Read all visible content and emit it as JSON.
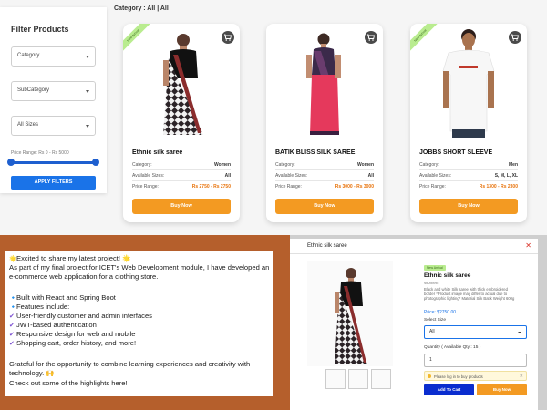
{
  "storefront": {
    "filter_title": "Filter Products",
    "category_placeholder": "Category",
    "subcategory_placeholder": "SubCategory",
    "size_value": "All Sizes",
    "price_range_label": "Price Range: Rs 0 - Rs 5000",
    "price_range": [
      0,
      5000
    ],
    "apply_label": "APPLY FILTERS",
    "breadcrumb": "Category : All | All",
    "labels": {
      "category": "Category:",
      "sizes": "Available Sizes:",
      "price": "Price Range:"
    },
    "products": [
      {
        "name": "Ethnic silk saree",
        "ribbon": "New Arrival",
        "category": "Women",
        "sizes": "All",
        "price": "Rs 2750 - Rs 2750",
        "buy_label": "Buy Now",
        "image": "saree-geometric"
      },
      {
        "name": "BATIK BLISS SILK SAREE",
        "ribbon": "",
        "category": "Women",
        "sizes": "All",
        "price": "Rs 3000 - Rs 3000",
        "buy_label": "Buy Now",
        "image": "saree-pink"
      },
      {
        "name": "JOBBS SHORT SLEEVE",
        "ribbon": "New Arrival",
        "category": "Men",
        "sizes": "S, M, L, XL",
        "price": "Rs 1300 - Rs 2300",
        "buy_label": "Buy Now",
        "image": "tshirt-white"
      }
    ],
    "icons": {
      "cart": "cart-icon"
    },
    "colors": {
      "accent": "#1a73e8",
      "buy": "#f39a22",
      "price": "#e8730b"
    }
  },
  "post": {
    "lines": [
      {
        "icon": "🌟",
        "text": "Excited to share my latest project! 🌟"
      },
      {
        "icon": "",
        "text": "As part of my final project for ICET's Web Development module, I have developed an"
      },
      {
        "icon": "",
        "text": "e-commerce web application for a clothing store."
      },
      {
        "icon": "",
        "text": ""
      },
      {
        "icon": "🔹",
        "text": "Built with React and Spring Boot"
      },
      {
        "icon": "🔹",
        "text": "Features include:"
      },
      {
        "icon": "✔",
        "text": "User-friendly customer and admin interfaces"
      },
      {
        "icon": "✔",
        "text": "JWT-based authentication"
      },
      {
        "icon": "✔",
        "text": "Responsive design for web and mobile"
      },
      {
        "icon": "✔",
        "text": "Shopping cart, order history, and more!"
      },
      {
        "icon": "",
        "text": ""
      },
      {
        "icon": "",
        "text": "Grateful for the opportunity to combine learning experiences and creativity with"
      },
      {
        "icon": "",
        "text": "technology. 🙌"
      },
      {
        "icon": "",
        "text": "Check out some of the highlights here!"
      }
    ]
  },
  "modal": {
    "title": "Ethnic silk saree",
    "close": "✕",
    "badge": "New Arrival",
    "name": "Ethnic silk saree",
    "subtitle": "Women",
    "description": "Black and white Silk saree with thick embroidered\nborder *Product image may differ to actual due to\nphotographic lighting* Material Silk Batik Weight 600g",
    "price": "Price: $2750.00",
    "size_label": "Select Size",
    "size_value": "All",
    "qty_label": "Quantity ( Available Qty : 15 )",
    "qty_value": "1",
    "alert": "Please log in to buy products",
    "add_to_cart": "Add To Cart",
    "buy_now": "Buy Now"
  }
}
